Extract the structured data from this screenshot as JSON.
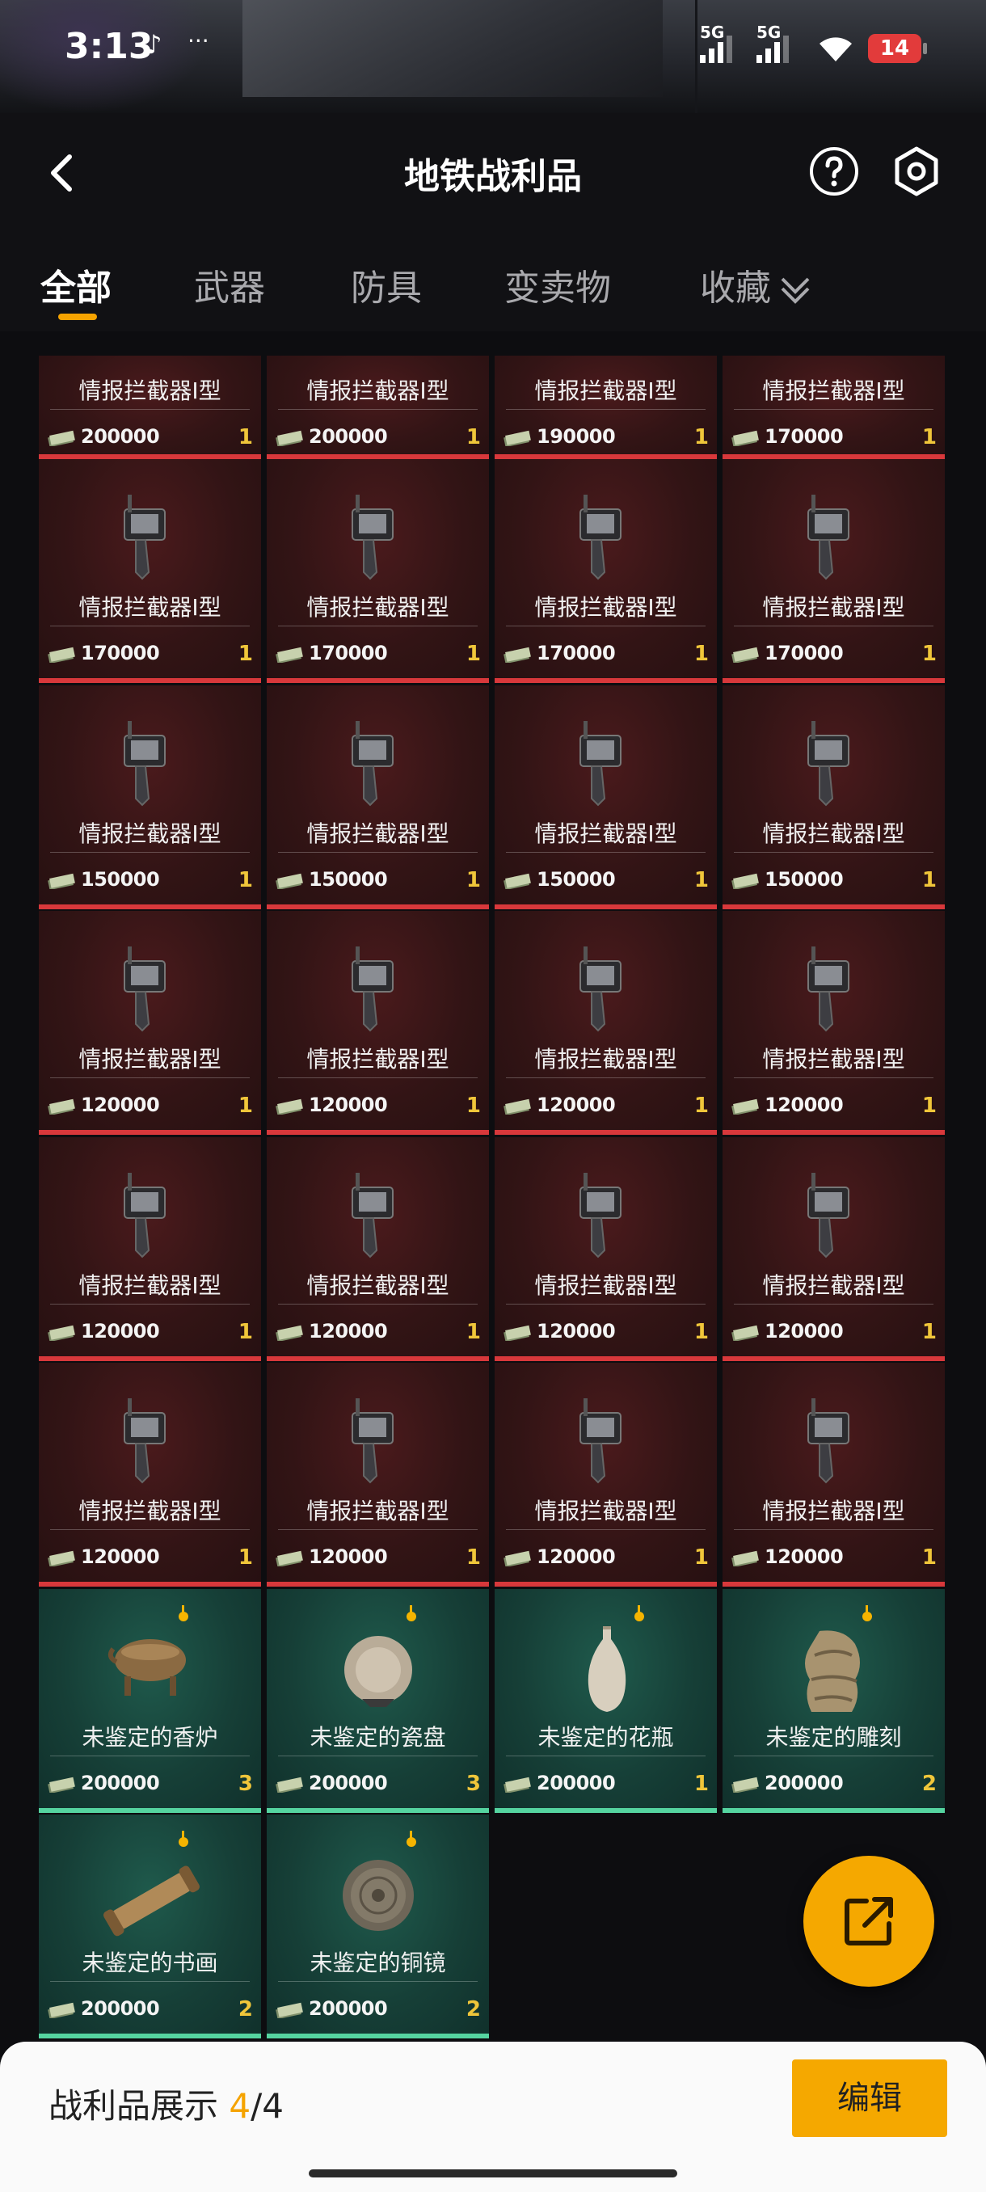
{
  "status_bar": {
    "time": "3:13",
    "network_1": "5G",
    "network_2": "5G",
    "battery": "14",
    "more": "···"
  },
  "header": {
    "title": "地铁战利品",
    "icons": [
      "back-icon",
      "help-icon",
      "settings-icon"
    ]
  },
  "tabs": [
    {
      "label": "全部",
      "active": true
    },
    {
      "label": "武器",
      "active": false
    },
    {
      "label": "防具",
      "active": false
    },
    {
      "label": "变卖物",
      "active": false
    },
    {
      "label": "收藏",
      "active": false
    }
  ],
  "items": [
    {
      "name": "情报拦截器I型",
      "price": "200000",
      "qty": "1",
      "kind": "red",
      "image": "none"
    },
    {
      "name": "情报拦截器I型",
      "price": "200000",
      "qty": "1",
      "kind": "red",
      "image": "none"
    },
    {
      "name": "情报拦截器I型",
      "price": "190000",
      "qty": "1",
      "kind": "red",
      "image": "none"
    },
    {
      "name": "情报拦截器I型",
      "price": "170000",
      "qty": "1",
      "kind": "red",
      "image": "none"
    },
    {
      "name": "情报拦截器I型",
      "price": "170000",
      "qty": "1",
      "kind": "red",
      "image": "device-icon"
    },
    {
      "name": "情报拦截器I型",
      "price": "170000",
      "qty": "1",
      "kind": "red",
      "image": "device-icon"
    },
    {
      "name": "情报拦截器I型",
      "price": "170000",
      "qty": "1",
      "kind": "red",
      "image": "device-icon"
    },
    {
      "name": "情报拦截器I型",
      "price": "170000",
      "qty": "1",
      "kind": "red",
      "image": "device-icon"
    },
    {
      "name": "情报拦截器I型",
      "price": "150000",
      "qty": "1",
      "kind": "red",
      "image": "device-icon"
    },
    {
      "name": "情报拦截器I型",
      "price": "150000",
      "qty": "1",
      "kind": "red",
      "image": "device-icon"
    },
    {
      "name": "情报拦截器I型",
      "price": "150000",
      "qty": "1",
      "kind": "red",
      "image": "device-icon"
    },
    {
      "name": "情报拦截器I型",
      "price": "150000",
      "qty": "1",
      "kind": "red",
      "image": "device-icon"
    },
    {
      "name": "情报拦截器I型",
      "price": "120000",
      "qty": "1",
      "kind": "red",
      "image": "device-icon"
    },
    {
      "name": "情报拦截器I型",
      "price": "120000",
      "qty": "1",
      "kind": "red",
      "image": "device-icon"
    },
    {
      "name": "情报拦截器I型",
      "price": "120000",
      "qty": "1",
      "kind": "red",
      "image": "device-icon"
    },
    {
      "name": "情报拦截器I型",
      "price": "120000",
      "qty": "1",
      "kind": "red",
      "image": "device-icon"
    },
    {
      "name": "情报拦截器I型",
      "price": "120000",
      "qty": "1",
      "kind": "red",
      "image": "device-icon"
    },
    {
      "name": "情报拦截器I型",
      "price": "120000",
      "qty": "1",
      "kind": "red",
      "image": "device-icon"
    },
    {
      "name": "情报拦截器I型",
      "price": "120000",
      "qty": "1",
      "kind": "red",
      "image": "device-icon"
    },
    {
      "name": "情报拦截器I型",
      "price": "120000",
      "qty": "1",
      "kind": "red",
      "image": "device-icon"
    },
    {
      "name": "情报拦截器I型",
      "price": "120000",
      "qty": "1",
      "kind": "red",
      "image": "device-icon"
    },
    {
      "name": "情报拦截器I型",
      "price": "120000",
      "qty": "1",
      "kind": "red",
      "image": "device-icon"
    },
    {
      "name": "情报拦截器I型",
      "price": "120000",
      "qty": "1",
      "kind": "red",
      "image": "device-icon"
    },
    {
      "name": "情报拦截器I型",
      "price": "120000",
      "qty": "1",
      "kind": "red",
      "image": "device-icon"
    },
    {
      "name": "未鉴定的香炉",
      "price": "200000",
      "qty": "3",
      "kind": "green",
      "image": "censer-icon"
    },
    {
      "name": "未鉴定的瓷盘",
      "price": "200000",
      "qty": "3",
      "kind": "green",
      "image": "plate-icon"
    },
    {
      "name": "未鉴定的花瓶",
      "price": "200000",
      "qty": "1",
      "kind": "green",
      "image": "vase-icon"
    },
    {
      "name": "未鉴定的雕刻",
      "price": "200000",
      "qty": "2",
      "kind": "green",
      "image": "carving-icon"
    },
    {
      "name": "未鉴定的书画",
      "price": "200000",
      "qty": "2",
      "kind": "green",
      "image": "scroll-icon"
    },
    {
      "name": "未鉴定的铜镜",
      "price": "200000",
      "qty": "2",
      "kind": "green",
      "image": "mirror-icon"
    }
  ],
  "fab": {
    "icon": "share-icon"
  },
  "bottom_bar": {
    "label": "战利品展示 ",
    "count": "4",
    "total": "/4",
    "edit_label": "编辑"
  },
  "colors": {
    "accent": "#f5a800",
    "red_card": "#321415",
    "green_card": "#163f37",
    "price_text": "#f0c63a"
  }
}
